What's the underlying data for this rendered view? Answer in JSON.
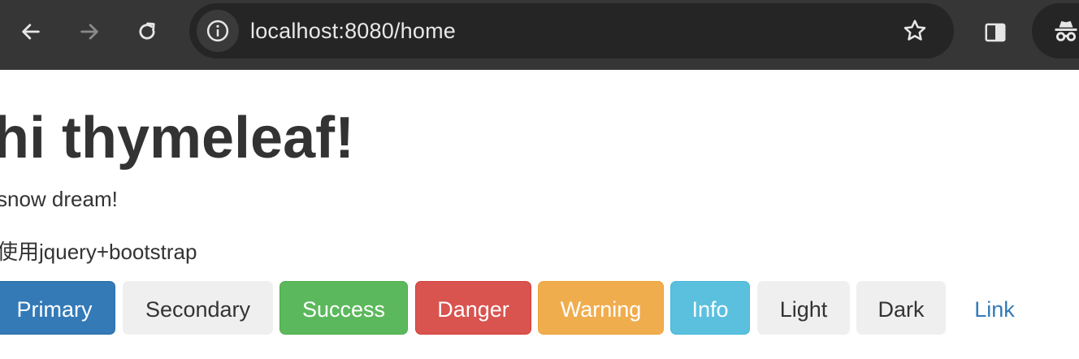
{
  "browser": {
    "url": "localhost:8080/home",
    "icons": {
      "back": "back-arrow-icon",
      "forward": "forward-arrow-icon",
      "reload": "reload-icon",
      "info": "info-icon",
      "bookmark": "star-icon",
      "side_panel": "side-panel-icon",
      "profile": "incognito-icon"
    }
  },
  "page": {
    "heading": "hi thymeleaf!",
    "line1": "snow dream!",
    "line2": "使用jquery+bootstrap",
    "buttons": [
      {
        "label": "Primary",
        "color": "#337ab7"
      },
      {
        "label": "Secondary",
        "color": "#efefef"
      },
      {
        "label": "Success",
        "color": "#5cb85c"
      },
      {
        "label": "Danger",
        "color": "#d9534f"
      },
      {
        "label": "Warning",
        "color": "#f0ad4e"
      },
      {
        "label": "Info",
        "color": "#5bc0de"
      },
      {
        "label": "Light",
        "color": "#efefef"
      },
      {
        "label": "Dark",
        "color": "#efefef"
      },
      {
        "label": "Link",
        "color": "#337ab7"
      }
    ]
  }
}
